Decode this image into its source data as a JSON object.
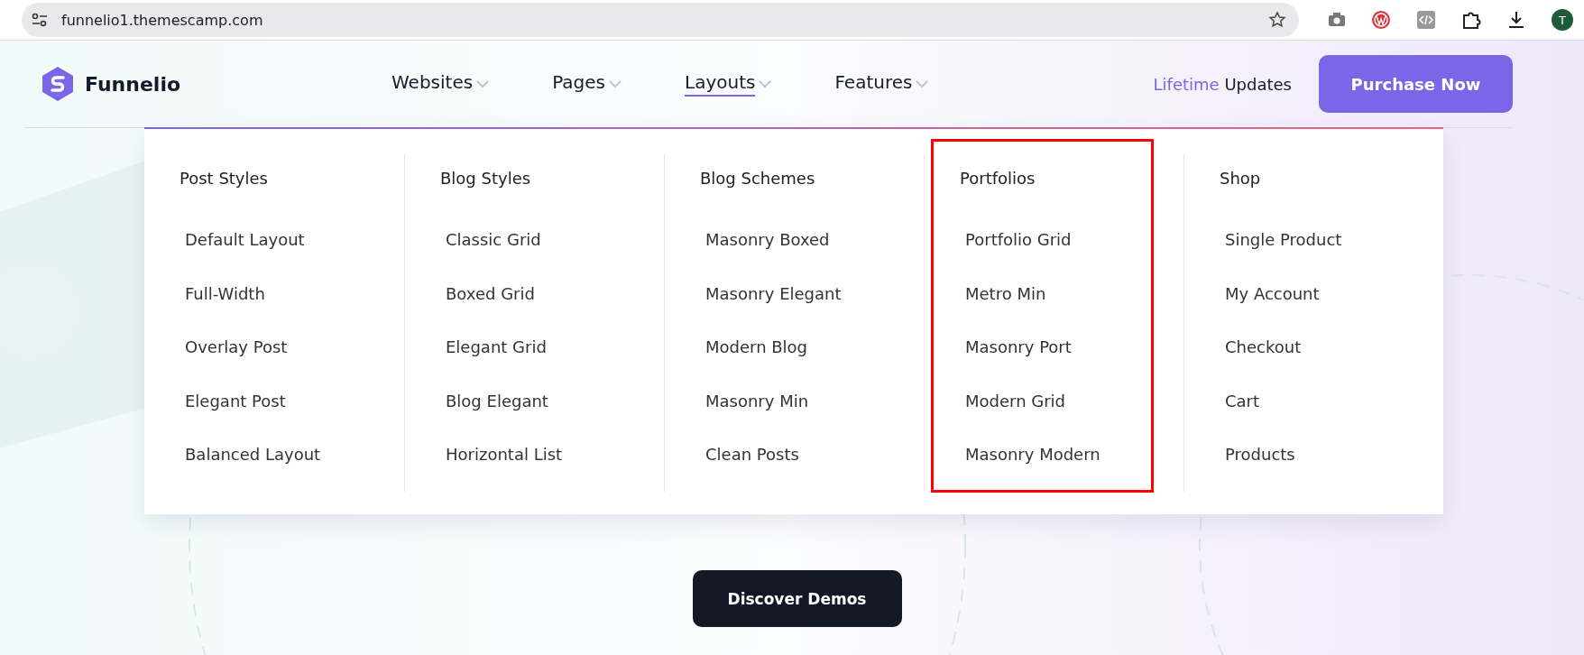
{
  "browser": {
    "url": "funnelio1.themescamp.com",
    "profile_initial": "T"
  },
  "header": {
    "logo": "Funnelio",
    "nav": [
      {
        "label": "Websites",
        "selected": false
      },
      {
        "label": "Pages",
        "selected": false
      },
      {
        "label": "Layouts",
        "selected": true
      },
      {
        "label": "Features",
        "selected": false
      }
    ],
    "updates": {
      "highlight": "Lifetime",
      "rest": "Updates"
    },
    "cta": "Purchase Now"
  },
  "mega_menu": {
    "columns": [
      {
        "heading": "Post Styles",
        "highlighted": false,
        "items": [
          "Default Layout",
          "Full-Width",
          "Overlay Post",
          "Elegant Post",
          "Balanced Layout"
        ]
      },
      {
        "heading": "Blog Styles",
        "highlighted": false,
        "items": [
          "Classic Grid",
          "Boxed Grid",
          "Elegant Grid",
          "Blog Elegant",
          "Horizontal List"
        ]
      },
      {
        "heading": "Blog Schemes",
        "highlighted": false,
        "items": [
          "Masonry Boxed",
          "Masonry Elegant",
          "Modern Blog",
          "Masonry Min",
          "Clean Posts"
        ]
      },
      {
        "heading": "Portfolios",
        "highlighted": true,
        "items": [
          "Portfolio Grid",
          "Metro Min",
          "Masonry Port",
          "Modern Grid",
          "Masonry Modern"
        ]
      },
      {
        "heading": "Shop",
        "highlighted": false,
        "items": [
          "Single Product",
          "My Account",
          "Checkout",
          "Cart",
          "Products"
        ]
      }
    ]
  },
  "hero": {
    "button": "Discover Demos"
  }
}
